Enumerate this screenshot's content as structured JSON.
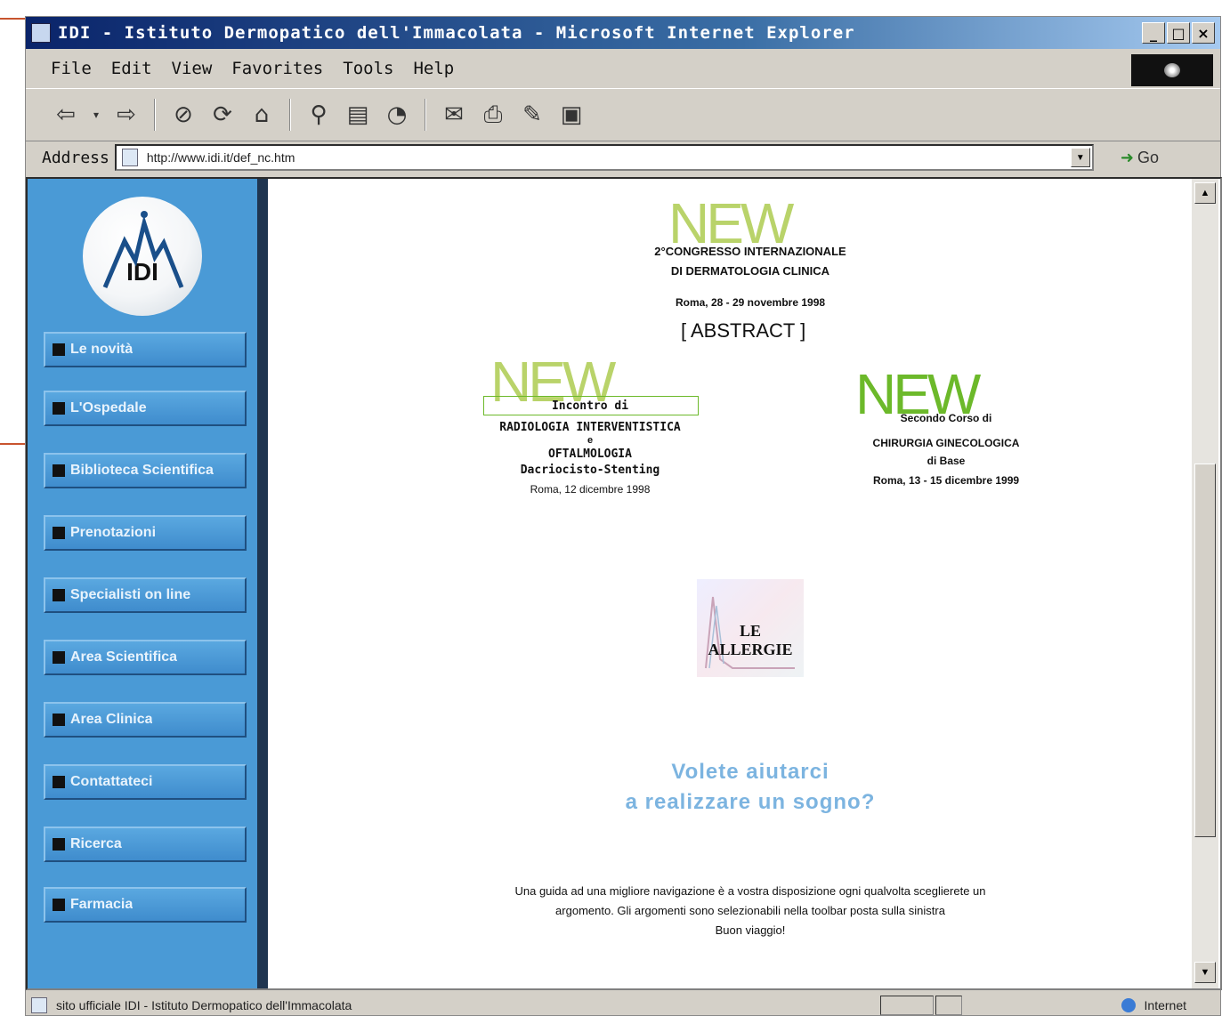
{
  "window": {
    "title": "IDI - Istituto Dermopatico dell'Immacolata - Microsoft Internet Explorer",
    "buttons": [
      "_",
      "□",
      "×"
    ]
  },
  "menubar": {
    "items": [
      "File",
      "Edit",
      "View",
      "Favorites",
      "Tools",
      "Help"
    ]
  },
  "toolbar": {
    "icons": [
      "back-icon",
      "forward-icon",
      "stop-icon",
      "refresh-icon",
      "home-icon",
      "search-icon",
      "favorites-icon",
      "history-icon",
      "mail-icon",
      "print-icon",
      "edit-icon",
      "discuss-icon"
    ]
  },
  "address": {
    "label": "Address",
    "url": "http://www.idi.it/def_nc.htm",
    "go_label": "Go"
  },
  "sidebar": {
    "logo_text": "IDI",
    "items": [
      {
        "label": "Le novità"
      },
      {
        "label": "L'Ospedale"
      },
      {
        "label": "Biblioteca Scientifica"
      },
      {
        "label": "Prenotazioni"
      },
      {
        "label": "Specialisti on line"
      },
      {
        "label": "Area Scientifica"
      },
      {
        "label": "Area Clinica"
      },
      {
        "label": "Contattateci"
      },
      {
        "label": "Ricerca"
      },
      {
        "label": "Farmacia"
      }
    ]
  },
  "content": {
    "new_label": "NEW",
    "congress": {
      "line1": "2°CONGRESSO INTERNAZIONALE",
      "line2": "DI DERMATOLOGIA CLINICA",
      "date": "Roma, 28 - 29 novembre 1998"
    },
    "abstract": "[ ABSTRACT ]",
    "left_event": {
      "line1": "Incontro di",
      "line2": "RADIOLOGIA INTERVENTISTICA",
      "line3": "e",
      "line4": "OFTALMOLOGIA",
      "line5": "Dacriocisto-Stenting",
      "date": "Roma, 12 dicembre 1998"
    },
    "right_event": {
      "line1": "Secondo Corso di",
      "line2": "CHIRURGIA GINECOLOGICA",
      "line3": "di Base",
      "date": "Roma, 13 - 15 dicembre 1999"
    },
    "allergy_label": "LE ALLERGIE",
    "dream_line1": "Volete aiutarci",
    "dream_line2": "a realizzare un sogno?",
    "help_line1": "Una guida ad una migliore navigazione è a vostra disposizione ogni qualvolta sceglierete un",
    "help_line2": "argomento. Gli argomenti sono selezionabili nella toolbar posta sulla sinistra",
    "help_line3": "Buon viaggio!"
  },
  "status": {
    "text": "sito ufficiale IDI - Istituto Dermopatico dell'Immacolata",
    "zone": "Internet"
  },
  "colors": {
    "sidebar": "#4a9ad6",
    "new_light": "#b9d36a",
    "new_green": "#6cb92a",
    "dream": "#7cb4e0"
  }
}
